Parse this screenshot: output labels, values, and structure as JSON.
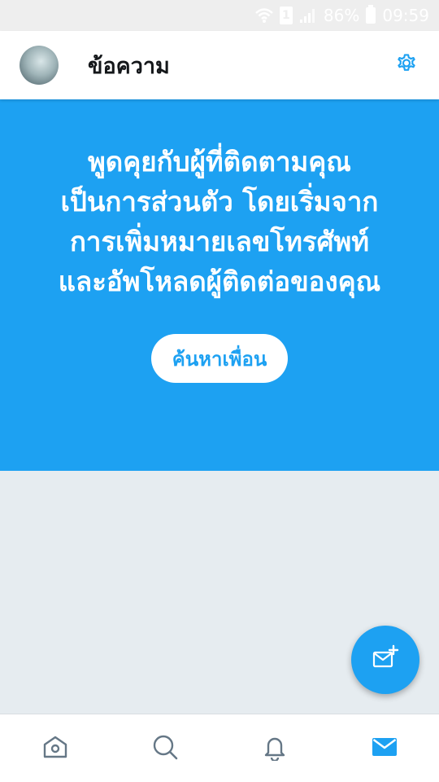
{
  "status_bar": {
    "battery": "86%",
    "time": "09:59",
    "sim_label": "1",
    "icons": [
      "wifi-icon",
      "sim-icon",
      "signal-icon",
      "battery-icon"
    ]
  },
  "header": {
    "title": "ข้อความ",
    "avatar": "profile-avatar",
    "settings_icon": "gear-icon"
  },
  "promo": {
    "message": "พูดคุยกับผู้ที่ติดตามคุณเป็นการส่วนตัว โดยเริ่มจากการเพิ่มหมายเลขโทรศัพท์และอัพโหลดผู้ติดต่อของคุณ",
    "button_label": "ค้นหาเพื่อน"
  },
  "fab": {
    "icon": "new-message-icon"
  },
  "bottom_nav": {
    "items": [
      {
        "name": "home",
        "icon": "home-icon",
        "active": false
      },
      {
        "name": "search",
        "icon": "search-icon",
        "active": false
      },
      {
        "name": "notifications",
        "icon": "bell-icon",
        "active": false
      },
      {
        "name": "messages",
        "icon": "mail-icon",
        "active": true
      }
    ]
  },
  "colors": {
    "accent": "#1da1f2",
    "background": "#e6ecf0",
    "inactive_icon": "#657786",
    "title_text": "#14171a"
  }
}
